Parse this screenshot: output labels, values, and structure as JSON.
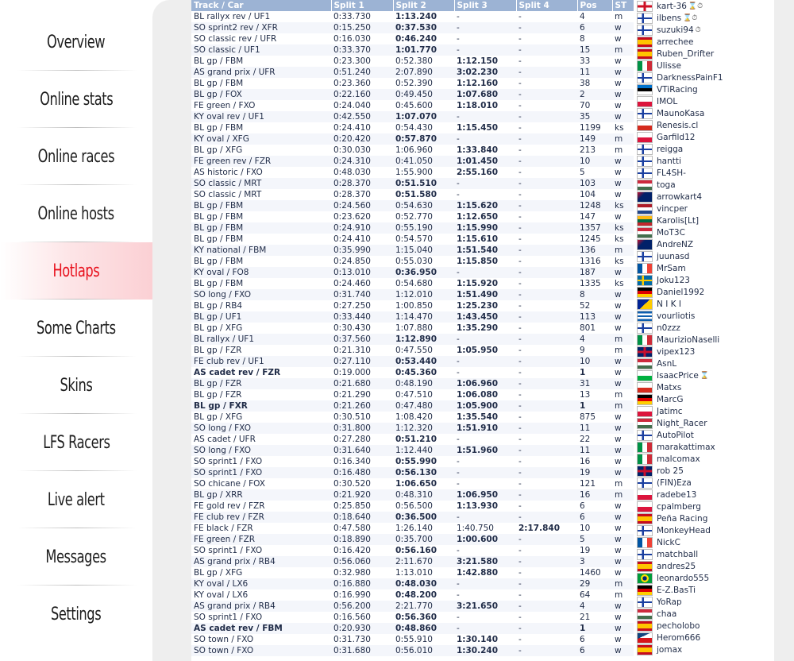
{
  "nav": [
    {
      "label": "Overview",
      "active": false
    },
    {
      "label": "Online stats",
      "active": false
    },
    {
      "label": "Online races",
      "active": false
    },
    {
      "label": "Online hosts",
      "active": false
    },
    {
      "label": "Hotlaps",
      "active": true
    },
    {
      "label": "Some Charts",
      "active": false
    },
    {
      "label": "Skins",
      "active": false
    },
    {
      "label": "LFS Racers",
      "active": false
    },
    {
      "label": "Live alert",
      "active": false
    },
    {
      "label": "Messages",
      "active": false
    },
    {
      "label": "Settings",
      "active": false
    }
  ],
  "table": {
    "headers": [
      "Track / Car",
      "Split 1",
      "Split 2",
      "Split 3",
      "Split 4",
      "Pos",
      "ST"
    ],
    "rows": [
      {
        "track": "BL rallyx rev / UF1",
        "s1": "0:33.730",
        "s2": "1:13.240",
        "s3": "-",
        "s4": "-",
        "pos": "4",
        "st": "m"
      },
      {
        "track": "SO sprint2 rev / XFR",
        "s1": "0:15.250",
        "s2": "0:37.530",
        "s3": "-",
        "s4": "-",
        "pos": "6",
        "st": "w"
      },
      {
        "track": "SO classic rev / UFR",
        "s1": "0:16.030",
        "s2": "0:46.240",
        "s3": "-",
        "s4": "-",
        "pos": "8",
        "st": "w"
      },
      {
        "track": "SO classic / UF1",
        "s1": "0:33.370",
        "s2": "1:01.770",
        "s3": "-",
        "s4": "-",
        "pos": "15",
        "st": "m"
      },
      {
        "track": "BL gp / FBM",
        "s1": "0:23.300",
        "s2": "0:52.380",
        "s3": "1:12.150",
        "s4": "-",
        "pos": "33",
        "st": "w"
      },
      {
        "track": "AS grand prix / UFR",
        "s1": "0:51.240",
        "s2": "2:07.890",
        "s3": "3:02.230",
        "s4": "-",
        "pos": "11",
        "st": "w"
      },
      {
        "track": "BL gp / FBM",
        "s1": "0:23.360",
        "s2": "0:52.390",
        "s3": "1:12.160",
        "s4": "-",
        "pos": "38",
        "st": "w"
      },
      {
        "track": "BL gp / FOX",
        "s1": "0:22.160",
        "s2": "0:49.450",
        "s3": "1:07.680",
        "s4": "-",
        "pos": "2",
        "st": "w"
      },
      {
        "track": "FE green / FXO",
        "s1": "0:24.040",
        "s2": "0:45.600",
        "s3": "1:18.010",
        "s4": "-",
        "pos": "70",
        "st": "w"
      },
      {
        "track": "KY oval rev / UF1",
        "s1": "0:42.550",
        "s2": "1:07.070",
        "s3": "-",
        "s4": "-",
        "pos": "35",
        "st": "w"
      },
      {
        "track": "BL gp / FBM",
        "s1": "0:24.410",
        "s2": "0:54.430",
        "s3": "1:15.450",
        "s4": "-",
        "pos": "1199",
        "st": "ks"
      },
      {
        "track": "KY oval / XFG",
        "s1": "0:20.420",
        "s2": "0:57.870",
        "s3": "-",
        "s4": "-",
        "pos": "149",
        "st": "m"
      },
      {
        "track": "BL gp / XFG",
        "s1": "0:30.030",
        "s2": "1:06.960",
        "s3": "1:33.840",
        "s4": "-",
        "pos": "213",
        "st": "m"
      },
      {
        "track": "FE green rev / FZR",
        "s1": "0:24.310",
        "s2": "0:41.050",
        "s3": "1:01.450",
        "s4": "-",
        "pos": "10",
        "st": "w"
      },
      {
        "track": "AS historic / FXO",
        "s1": "0:48.030",
        "s2": "1:55.900",
        "s3": "2:55.160",
        "s4": "-",
        "pos": "5",
        "st": "w"
      },
      {
        "track": "SO classic / MRT",
        "s1": "0:28.370",
        "s2": "0:51.510",
        "s3": "-",
        "s4": "-",
        "pos": "103",
        "st": "w"
      },
      {
        "track": "SO classic / MRT",
        "s1": "0:28.370",
        "s2": "0:51.580",
        "s3": "-",
        "s4": "-",
        "pos": "104",
        "st": "w"
      },
      {
        "track": "BL gp / FBM",
        "s1": "0:24.560",
        "s2": "0:54.630",
        "s3": "1:15.620",
        "s4": "-",
        "pos": "1248",
        "st": "ks"
      },
      {
        "track": "BL gp / FBM",
        "s1": "0:23.620",
        "s2": "0:52.770",
        "s3": "1:12.650",
        "s4": "-",
        "pos": "147",
        "st": "w"
      },
      {
        "track": "BL gp / FBM",
        "s1": "0:24.910",
        "s2": "0:55.190",
        "s3": "1:15.990",
        "s4": "-",
        "pos": "1357",
        "st": "ks"
      },
      {
        "track": "BL gp / FBM",
        "s1": "0:24.410",
        "s2": "0:54.570",
        "s3": "1:15.610",
        "s4": "-",
        "pos": "1245",
        "st": "ks"
      },
      {
        "track": "KY national / FBM",
        "s1": "0:35.990",
        "s2": "1:15.040",
        "s3": "1:51.540",
        "s4": "-",
        "pos": "136",
        "st": "m"
      },
      {
        "track": "BL gp / FBM",
        "s1": "0:24.850",
        "s2": "0:55.030",
        "s3": "1:15.850",
        "s4": "-",
        "pos": "1316",
        "st": "ks"
      },
      {
        "track": "KY oval / FO8",
        "s1": "0:13.010",
        "s2": "0:36.950",
        "s3": "-",
        "s4": "-",
        "pos": "187",
        "st": "w"
      },
      {
        "track": "BL gp / FBM",
        "s1": "0:24.460",
        "s2": "0:54.680",
        "s3": "1:15.920",
        "s4": "-",
        "pos": "1335",
        "st": "ks"
      },
      {
        "track": "SO long / FXO",
        "s1": "0:31.740",
        "s2": "1:12.010",
        "s3": "1:51.490",
        "s4": "-",
        "pos": "8",
        "st": "w"
      },
      {
        "track": "BL gp / RB4",
        "s1": "0:27.250",
        "s2": "1:00.850",
        "s3": "1:25.230",
        "s4": "-",
        "pos": "52",
        "st": "w"
      },
      {
        "track": "BL gp / UF1",
        "s1": "0:33.440",
        "s2": "1:14.470",
        "s3": "1:43.450",
        "s4": "-",
        "pos": "113",
        "st": "w"
      },
      {
        "track": "BL gp / XFG",
        "s1": "0:30.430",
        "s2": "1:07.880",
        "s3": "1:35.290",
        "s4": "-",
        "pos": "801",
        "st": "w"
      },
      {
        "track": "BL rallyx / UF1",
        "s1": "0:37.560",
        "s2": "1:12.890",
        "s3": "-",
        "s4": "-",
        "pos": "4",
        "st": "m"
      },
      {
        "track": "BL gp / FZR",
        "s1": "0:21.310",
        "s2": "0:47.550",
        "s3": "1:05.950",
        "s4": "-",
        "pos": "9",
        "st": "m"
      },
      {
        "track": "FE club rev / UF1",
        "s1": "0:27.110",
        "s2": "0:53.440",
        "s3": "-",
        "s4": "-",
        "pos": "10",
        "st": "w"
      },
      {
        "track": "AS cadet rev / FZR",
        "s1": "0:19.000",
        "s2": "0:45.360",
        "s3": "-",
        "s4": "-",
        "pos": "1",
        "st": "w",
        "bold": true
      },
      {
        "track": "BL gp / FZR",
        "s1": "0:21.680",
        "s2": "0:48.190",
        "s3": "1:06.960",
        "s4": "-",
        "pos": "31",
        "st": "w"
      },
      {
        "track": "BL gp / FZR",
        "s1": "0:21.290",
        "s2": "0:47.510",
        "s3": "1:06.080",
        "s4": "-",
        "pos": "13",
        "st": "m"
      },
      {
        "track": "BL gp / FXR",
        "s1": "0:21.260",
        "s2": "0:47.480",
        "s3": "1:05.900",
        "s4": "-",
        "pos": "1",
        "st": "m",
        "bold": true
      },
      {
        "track": "BL gp / XFG",
        "s1": "0:30.510",
        "s2": "1:08.420",
        "s3": "1:35.540",
        "s4": "-",
        "pos": "875",
        "st": "w"
      },
      {
        "track": "SO long / FXO",
        "s1": "0:31.800",
        "s2": "1:12.320",
        "s3": "1:51.910",
        "s4": "-",
        "pos": "11",
        "st": "w"
      },
      {
        "track": "AS cadet / UFR",
        "s1": "0:27.280",
        "s2": "0:51.210",
        "s3": "-",
        "s4": "-",
        "pos": "22",
        "st": "w"
      },
      {
        "track": "SO long / FXO",
        "s1": "0:31.640",
        "s2": "1:12.440",
        "s3": "1:51.960",
        "s4": "-",
        "pos": "11",
        "st": "w"
      },
      {
        "track": "SO sprint1 / FXO",
        "s1": "0:16.340",
        "s2": "0:55.990",
        "s3": "-",
        "s4": "-",
        "pos": "16",
        "st": "w"
      },
      {
        "track": "SO sprint1 / FXO",
        "s1": "0:16.480",
        "s2": "0:56.130",
        "s3": "-",
        "s4": "-",
        "pos": "19",
        "st": "w"
      },
      {
        "track": "SO chicane / FOX",
        "s1": "0:30.520",
        "s2": "1:06.650",
        "s3": "-",
        "s4": "-",
        "pos": "121",
        "st": "m"
      },
      {
        "track": "BL gp / XRR",
        "s1": "0:21.920",
        "s2": "0:48.310",
        "s3": "1:06.950",
        "s4": "-",
        "pos": "16",
        "st": "m"
      },
      {
        "track": "FE gold rev / FZR",
        "s1": "0:25.850",
        "s2": "0:56.500",
        "s3": "1:13.930",
        "s4": "-",
        "pos": "6",
        "st": "w"
      },
      {
        "track": "FE club rev / FZR",
        "s1": "0:18.640",
        "s2": "0:36.500",
        "s3": "-",
        "s4": "-",
        "pos": "6",
        "st": "w"
      },
      {
        "track": "FE black / FZR",
        "s1": "0:47.580",
        "s2": "1:26.140",
        "s3": "1:40.750",
        "s4": "2:17.840",
        "pos": "10",
        "st": "w",
        "s3plain": true
      },
      {
        "track": "FE green / FZR",
        "s1": "0:18.890",
        "s2": "0:35.700",
        "s3": "1:00.600",
        "s4": "-",
        "pos": "5",
        "st": "w"
      },
      {
        "track": "SO sprint1 / FXO",
        "s1": "0:16.420",
        "s2": "0:56.160",
        "s3": "-",
        "s4": "-",
        "pos": "19",
        "st": "w"
      },
      {
        "track": "AS grand prix / RB4",
        "s1": "0:56.060",
        "s2": "2:11.670",
        "s3": "3:21.580",
        "s4": "-",
        "pos": "3",
        "st": "w"
      },
      {
        "track": "BL gp / XFG",
        "s1": "0:32.980",
        "s2": "1:13.010",
        "s3": "1:42.880",
        "s4": "-",
        "pos": "1460",
        "st": "w"
      },
      {
        "track": "KY oval / LX6",
        "s1": "0:16.880",
        "s2": "0:48.030",
        "s3": "-",
        "s4": "-",
        "pos": "29",
        "st": "m"
      },
      {
        "track": "KY oval / LX6",
        "s1": "0:16.990",
        "s2": "0:48.200",
        "s3": "-",
        "s4": "-",
        "pos": "64",
        "st": "m"
      },
      {
        "track": "AS grand prix / RB4",
        "s1": "0:56.200",
        "s2": "2:21.770",
        "s3": "3:21.650",
        "s4": "-",
        "pos": "4",
        "st": "w"
      },
      {
        "track": "SO sprint1 / FXO",
        "s1": "0:16.560",
        "s2": "0:56.360",
        "s3": "-",
        "s4": "-",
        "pos": "21",
        "st": "w"
      },
      {
        "track": "AS cadet rev / FBM",
        "s1": "0:20.930",
        "s2": "0:48.860",
        "s3": "-",
        "s4": "-",
        "pos": "1",
        "st": "w",
        "bold": true
      },
      {
        "track": "SO town / FXO",
        "s1": "0:31.730",
        "s2": "0:55.910",
        "s3": "1:30.140",
        "s4": "-",
        "pos": "6",
        "st": "w"
      },
      {
        "track": "SO town / FXO",
        "s1": "0:31.680",
        "s2": "0:56.010",
        "s3": "1:30.240",
        "s4": "-",
        "pos": "6",
        "st": "w"
      }
    ]
  },
  "racers": [
    {
      "name": "kart-36",
      "flag": "eng",
      "icons": "⌛⏱"
    },
    {
      "name": "ilbens",
      "flag": "fi",
      "icons": "⌛⏱"
    },
    {
      "name": "suzuki94",
      "flag": "fi",
      "icons": "⏱"
    },
    {
      "name": "arrechee",
      "flag": "es",
      "icons": ""
    },
    {
      "name": "Ruben_Drifter",
      "flag": "es",
      "icons": ""
    },
    {
      "name": "Ulisse",
      "flag": "it",
      "icons": ""
    },
    {
      "name": "DarknessPainF1",
      "flag": "fi",
      "icons": ""
    },
    {
      "name": "VTiRacing",
      "flag": "ee",
      "icons": ""
    },
    {
      "name": "IMOL",
      "flag": "pl",
      "icons": ""
    },
    {
      "name": "MaunoKasa",
      "flag": "fi",
      "icons": ""
    },
    {
      "name": "Renesis.cl",
      "flag": "cl",
      "icons": ""
    },
    {
      "name": "Garfild12",
      "flag": "pl",
      "icons": ""
    },
    {
      "name": "reigga",
      "flag": "fi",
      "icons": ""
    },
    {
      "name": "hantti",
      "flag": "fi",
      "icons": ""
    },
    {
      "name": "FL4SH-",
      "flag": "fi",
      "icons": ""
    },
    {
      "name": "toga",
      "flag": "hu",
      "icons": ""
    },
    {
      "name": "arrowkart4",
      "flag": "au",
      "icons": ""
    },
    {
      "name": "vincper",
      "flag": "nl",
      "icons": ""
    },
    {
      "name": "Karolis[Lt]",
      "flag": "lt",
      "icons": ""
    },
    {
      "name": "MoT3C",
      "flag": "hu",
      "icons": ""
    },
    {
      "name": "AndreNZ",
      "flag": "nz",
      "icons": ""
    },
    {
      "name": "juunasd",
      "flag": "fi",
      "icons": ""
    },
    {
      "name": "MrSam",
      "flag": "fr",
      "icons": ""
    },
    {
      "name": "Joku123",
      "flag": "se",
      "icons": ""
    },
    {
      "name": "Daniel1992",
      "flag": "de",
      "icons": ""
    },
    {
      "name": "N I K I",
      "flag": "ba",
      "icons": ""
    },
    {
      "name": "vourliotis",
      "flag": "gr",
      "icons": ""
    },
    {
      "name": "n0zzz",
      "flag": "fi",
      "icons": ""
    },
    {
      "name": "MaurizioNaselli",
      "flag": "it",
      "icons": ""
    },
    {
      "name": "vipex123",
      "flag": "gb",
      "icons": ""
    },
    {
      "name": "AsnL",
      "flag": "hu",
      "icons": ""
    },
    {
      "name": "IsaacPrice",
      "flag": "wales",
      "icons": "⌛"
    },
    {
      "name": "Matxs",
      "flag": "cl",
      "icons": ""
    },
    {
      "name": "MarcG",
      "flag": "de",
      "icons": ""
    },
    {
      "name": "Jatimc",
      "flag": "pl",
      "icons": ""
    },
    {
      "name": "Night_Racer",
      "flag": "hu",
      "icons": ""
    },
    {
      "name": "AutoPilot",
      "flag": "fi",
      "icons": ""
    },
    {
      "name": "marakattimax",
      "flag": "it",
      "icons": ""
    },
    {
      "name": "malcomax",
      "flag": "it",
      "icons": ""
    },
    {
      "name": "rob 25",
      "flag": "gb",
      "icons": ""
    },
    {
      "name": "(FIN)Eza",
      "flag": "fi",
      "icons": ""
    },
    {
      "name": "radebe13",
      "flag": "pl",
      "icons": ""
    },
    {
      "name": "cpalmberg",
      "flag": "pl",
      "icons": ""
    },
    {
      "name": "Peña Racing",
      "flag": "es",
      "icons": ""
    },
    {
      "name": "MonkeyHead",
      "flag": "fi",
      "icons": ""
    },
    {
      "name": "NickC",
      "flag": "fr",
      "icons": ""
    },
    {
      "name": "matchball",
      "flag": "fi",
      "icons": ""
    },
    {
      "name": "andres25",
      "flag": "es",
      "icons": ""
    },
    {
      "name": "leonardo555",
      "flag": "br",
      "icons": ""
    },
    {
      "name": "E-Z.BasTi",
      "flag": "de",
      "icons": ""
    },
    {
      "name": "YoRap",
      "flag": "fi",
      "icons": ""
    },
    {
      "name": "chaa",
      "flag": "hu",
      "icons": ""
    },
    {
      "name": "pecholobo",
      "flag": "es",
      "icons": ""
    },
    {
      "name": "Herom666",
      "flag": "cz",
      "icons": ""
    },
    {
      "name": "jomax",
      "flag": "es",
      "icons": ""
    }
  ],
  "flag_colors": {
    "fi": "linear-gradient(90deg,transparent 30%,#1a3fa0 30%,#1a3fa0 45%,transparent 45%),linear-gradient(0deg,#fff 40%,#1a3fa0 40%,#1a3fa0 60%,#fff 60%)",
    "es": "linear-gradient(0deg,#c60b1e 25%,#ffc400 25%,#ffc400 75%,#c60b1e 75%)",
    "it": "linear-gradient(90deg,#009246 33%,#fff 33%,#fff 66%,#ce2b37 66%)",
    "fr": "linear-gradient(90deg,#0055a4 33%,#fff 33%,#fff 66%,#ef4135 66%)",
    "de": "linear-gradient(0deg,#ffce00 33%,#dd0000 33%,#dd0000 66%,#000 66%)",
    "pl": "linear-gradient(0deg,#dc143c 50%,#fff 50%)",
    "hu": "linear-gradient(0deg,#436f4d 33%,#fff 33%,#fff 66%,#cd2a3e 66%)",
    "nl": "linear-gradient(0deg,#21468b 33%,#fff 33%,#fff 66%,#ae1c28 66%)",
    "lt": "linear-gradient(0deg,#c1272d 33%,#006a44 33%,#006a44 66%,#fdb913 66%)",
    "ee": "linear-gradient(0deg,#fff 33%,#000 33%,#000 66%,#0072ce 66%)",
    "cl": "linear-gradient(0deg,#d52b1e 50%,#fff 50%)",
    "se": "linear-gradient(90deg,transparent 30%,#fecc00 30%,#fecc00 45%,transparent 45%),linear-gradient(0deg,#006aa7 40%,#fecc00 40%,#fecc00 60%,#006aa7 60%)",
    "gb": "linear-gradient(90deg,transparent 42%,#c8102e 42%,#c8102e 58%,transparent 58%),linear-gradient(0deg,#012169 38%,#c8102e 38%,#c8102e 62%,#012169 62%)",
    "eng": "linear-gradient(90deg,transparent 42%,#ce1124 42%,#ce1124 58%,transparent 58%),linear-gradient(0deg,#fff 38%,#ce1124 38%,#ce1124 62%,#fff 62%)",
    "au": "linear-gradient(135deg,#c8102e 0%,#012169 35%,#012169 100%)",
    "nz": "linear-gradient(135deg,#c8102e 0%,#012169 35%,#012169 100%)",
    "ba": "linear-gradient(135deg,#002395 50%,#fecb00 50%)",
    "gr": "linear-gradient(0deg,#0d5eaf 20%,#fff 20%,#fff 40%,#0d5eaf 40%,#0d5eaf 60%,#fff 60%,#fff 80%,#0d5eaf 80%)",
    "wales": "linear-gradient(0deg,#00b140 50%,#fff 50%)",
    "br": "radial-gradient(circle,#002776 25%,#fedf00 26%,#fedf00 45%,#009c3b 46%)",
    "cz": "linear-gradient(155deg,#11457e 35%,transparent 35%),linear-gradient(0deg,#d7141a 50%,#fff 50%)"
  }
}
